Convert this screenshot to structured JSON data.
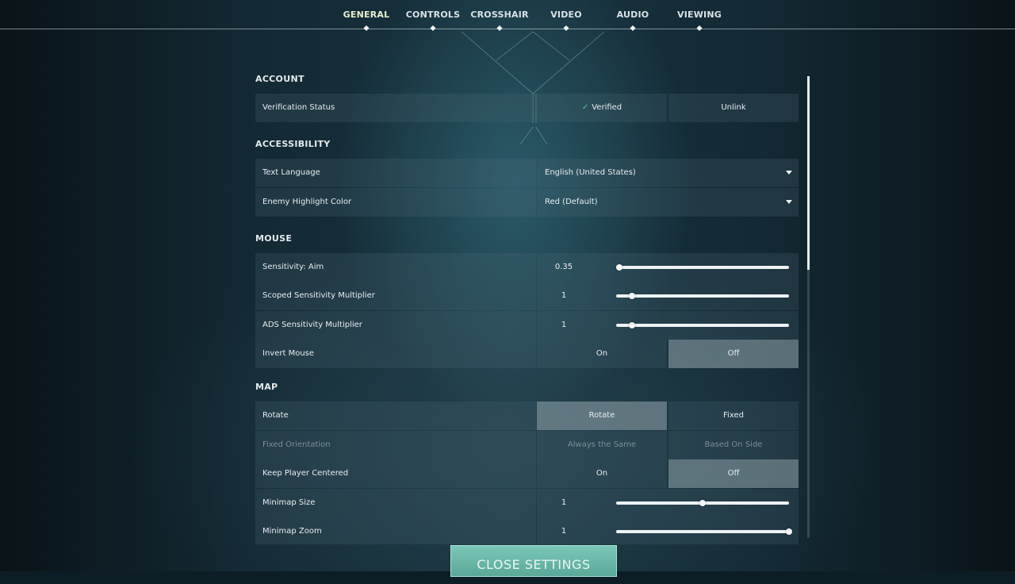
{
  "nav": {
    "tabs": [
      {
        "label": "GENERAL",
        "active": true
      },
      {
        "label": "CONTROLS",
        "active": false
      },
      {
        "label": "CROSSHAIR",
        "active": false
      },
      {
        "label": "VIDEO",
        "active": false
      },
      {
        "label": "AUDIO",
        "active": false
      },
      {
        "label": "VIEWING",
        "active": false
      }
    ]
  },
  "account": {
    "title": "ACCOUNT",
    "verification": {
      "label": "Verification Status",
      "status": "Verified",
      "action": "Unlink"
    }
  },
  "accessibility": {
    "title": "ACCESSIBILITY",
    "text_language": {
      "label": "Text Language",
      "value": "English (United States)"
    },
    "enemy_highlight": {
      "label": "Enemy Highlight Color",
      "value": "Red (Default)"
    }
  },
  "mouse": {
    "title": "MOUSE",
    "sensitivity_aim": {
      "label": "Sensitivity: Aim",
      "value": "0.35",
      "fraction": 0.02
    },
    "scoped_multiplier": {
      "label": "Scoped Sensitivity Multiplier",
      "value": "1",
      "fraction": 0.09
    },
    "ads_multiplier": {
      "label": "ADS Sensitivity Multiplier",
      "value": "1",
      "fraction": 0.09
    },
    "invert_mouse": {
      "label": "Invert Mouse",
      "on": "On",
      "off": "Off",
      "selected": "off"
    }
  },
  "map": {
    "title": "MAP",
    "rotate": {
      "label": "Rotate",
      "left": "Rotate",
      "right": "Fixed",
      "selected": "left"
    },
    "fixed_orientation": {
      "label": "Fixed Orientation",
      "left": "Always the Same",
      "right": "Based On Side",
      "disabled": true
    },
    "keep_player_centered": {
      "label": "Keep Player Centered",
      "on": "On",
      "off": "Off",
      "selected": "off"
    },
    "minimap_size": {
      "label": "Minimap Size",
      "value": "1",
      "fraction": 0.5
    },
    "minimap_zoom": {
      "label": "Minimap Zoom",
      "value": "1",
      "fraction": 1.0
    }
  },
  "close_button": {
    "label": "CLOSE SETTINGS"
  },
  "colors": {
    "accent": "#5aa898",
    "verified": "#4cd28a"
  }
}
